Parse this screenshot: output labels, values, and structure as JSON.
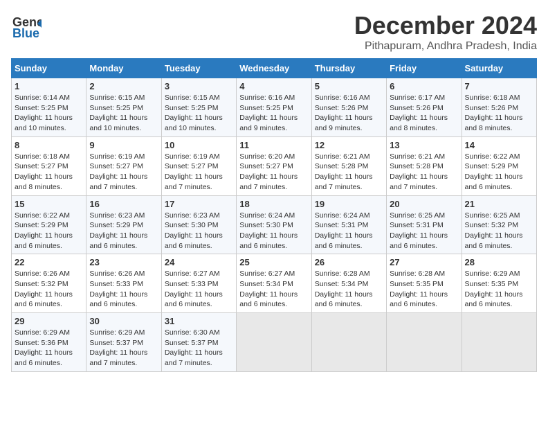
{
  "header": {
    "logo_line1": "General",
    "logo_line2": "Blue",
    "month_title": "December 2024",
    "location": "Pithapuram, Andhra Pradesh, India"
  },
  "days_of_week": [
    "Sunday",
    "Monday",
    "Tuesday",
    "Wednesday",
    "Thursday",
    "Friday",
    "Saturday"
  ],
  "weeks": [
    [
      {
        "day": 1,
        "sunrise": "6:14 AM",
        "sunset": "5:25 PM",
        "daylight": "11 hours and 10 minutes."
      },
      {
        "day": 2,
        "sunrise": "6:15 AM",
        "sunset": "5:25 PM",
        "daylight": "11 hours and 10 minutes."
      },
      {
        "day": 3,
        "sunrise": "6:15 AM",
        "sunset": "5:25 PM",
        "daylight": "11 hours and 10 minutes."
      },
      {
        "day": 4,
        "sunrise": "6:16 AM",
        "sunset": "5:25 PM",
        "daylight": "11 hours and 9 minutes."
      },
      {
        "day": 5,
        "sunrise": "6:16 AM",
        "sunset": "5:26 PM",
        "daylight": "11 hours and 9 minutes."
      },
      {
        "day": 6,
        "sunrise": "6:17 AM",
        "sunset": "5:26 PM",
        "daylight": "11 hours and 8 minutes."
      },
      {
        "day": 7,
        "sunrise": "6:18 AM",
        "sunset": "5:26 PM",
        "daylight": "11 hours and 8 minutes."
      }
    ],
    [
      {
        "day": 8,
        "sunrise": "6:18 AM",
        "sunset": "5:27 PM",
        "daylight": "11 hours and 8 minutes."
      },
      {
        "day": 9,
        "sunrise": "6:19 AM",
        "sunset": "5:27 PM",
        "daylight": "11 hours and 7 minutes."
      },
      {
        "day": 10,
        "sunrise": "6:19 AM",
        "sunset": "5:27 PM",
        "daylight": "11 hours and 7 minutes."
      },
      {
        "day": 11,
        "sunrise": "6:20 AM",
        "sunset": "5:27 PM",
        "daylight": "11 hours and 7 minutes."
      },
      {
        "day": 12,
        "sunrise": "6:21 AM",
        "sunset": "5:28 PM",
        "daylight": "11 hours and 7 minutes."
      },
      {
        "day": 13,
        "sunrise": "6:21 AM",
        "sunset": "5:28 PM",
        "daylight": "11 hours and 7 minutes."
      },
      {
        "day": 14,
        "sunrise": "6:22 AM",
        "sunset": "5:29 PM",
        "daylight": "11 hours and 6 minutes."
      }
    ],
    [
      {
        "day": 15,
        "sunrise": "6:22 AM",
        "sunset": "5:29 PM",
        "daylight": "11 hours and 6 minutes."
      },
      {
        "day": 16,
        "sunrise": "6:23 AM",
        "sunset": "5:29 PM",
        "daylight": "11 hours and 6 minutes."
      },
      {
        "day": 17,
        "sunrise": "6:23 AM",
        "sunset": "5:30 PM",
        "daylight": "11 hours and 6 minutes."
      },
      {
        "day": 18,
        "sunrise": "6:24 AM",
        "sunset": "5:30 PM",
        "daylight": "11 hours and 6 minutes."
      },
      {
        "day": 19,
        "sunrise": "6:24 AM",
        "sunset": "5:31 PM",
        "daylight": "11 hours and 6 minutes."
      },
      {
        "day": 20,
        "sunrise": "6:25 AM",
        "sunset": "5:31 PM",
        "daylight": "11 hours and 6 minutes."
      },
      {
        "day": 21,
        "sunrise": "6:25 AM",
        "sunset": "5:32 PM",
        "daylight": "11 hours and 6 minutes."
      }
    ],
    [
      {
        "day": 22,
        "sunrise": "6:26 AM",
        "sunset": "5:32 PM",
        "daylight": "11 hours and 6 minutes."
      },
      {
        "day": 23,
        "sunrise": "6:26 AM",
        "sunset": "5:33 PM",
        "daylight": "11 hours and 6 minutes."
      },
      {
        "day": 24,
        "sunrise": "6:27 AM",
        "sunset": "5:33 PM",
        "daylight": "11 hours and 6 minutes."
      },
      {
        "day": 25,
        "sunrise": "6:27 AM",
        "sunset": "5:34 PM",
        "daylight": "11 hours and 6 minutes."
      },
      {
        "day": 26,
        "sunrise": "6:28 AM",
        "sunset": "5:34 PM",
        "daylight": "11 hours and 6 minutes."
      },
      {
        "day": 27,
        "sunrise": "6:28 AM",
        "sunset": "5:35 PM",
        "daylight": "11 hours and 6 minutes."
      },
      {
        "day": 28,
        "sunrise": "6:29 AM",
        "sunset": "5:35 PM",
        "daylight": "11 hours and 6 minutes."
      }
    ],
    [
      {
        "day": 29,
        "sunrise": "6:29 AM",
        "sunset": "5:36 PM",
        "daylight": "11 hours and 6 minutes."
      },
      {
        "day": 30,
        "sunrise": "6:29 AM",
        "sunset": "5:37 PM",
        "daylight": "11 hours and 7 minutes."
      },
      {
        "day": 31,
        "sunrise": "6:30 AM",
        "sunset": "5:37 PM",
        "daylight": "11 hours and 7 minutes."
      },
      null,
      null,
      null,
      null
    ]
  ],
  "labels": {
    "sunrise": "Sunrise:",
    "sunset": "Sunset:",
    "daylight": "Daylight:"
  }
}
